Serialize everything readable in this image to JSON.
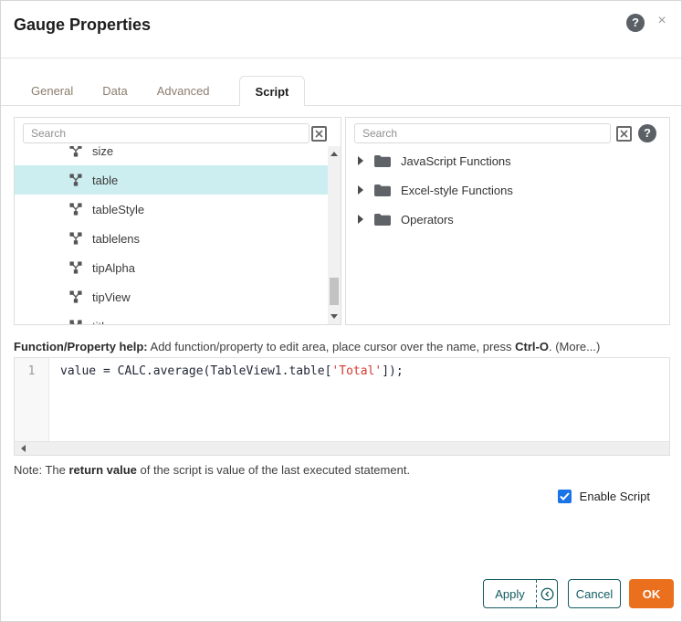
{
  "dialog": {
    "title": "Gauge Properties",
    "help_icon": "?",
    "close_icon": "×"
  },
  "tabs": [
    {
      "label": "General",
      "active": false
    },
    {
      "label": "Data",
      "active": false
    },
    {
      "label": "Advanced",
      "active": false
    },
    {
      "label": "Script",
      "active": true
    }
  ],
  "properties_panel": {
    "search_placeholder": "Search",
    "items": [
      {
        "label": "size",
        "selected": false
      },
      {
        "label": "table",
        "selected": true
      },
      {
        "label": "tableStyle",
        "selected": false
      },
      {
        "label": "tablelens",
        "selected": false
      },
      {
        "label": "tipAlpha",
        "selected": false
      },
      {
        "label": "tipView",
        "selected": false
      },
      {
        "label": "title",
        "selected": false
      }
    ]
  },
  "functions_panel": {
    "search_placeholder": "Search",
    "help_icon": "?",
    "tree": [
      {
        "label": "JavaScript Functions",
        "expanded": false
      },
      {
        "label": "Excel-style Functions",
        "expanded": false
      },
      {
        "label": "Operators",
        "expanded": false
      }
    ]
  },
  "help_line": {
    "bold_prefix": "Function/Property help:",
    "text": " Add function/property to edit area, place cursor over the name, press ",
    "shortcut": "Ctrl-O",
    "separator": ". ",
    "more_link": "(More...)"
  },
  "editor": {
    "line_number": "1",
    "code_before": "value = CALC.average(TableView1.table[",
    "code_string": "'Total'",
    "code_after": "]);"
  },
  "note": {
    "prefix": "Note: The ",
    "bold": "return value",
    "suffix": " of the script is value of the last executed statement."
  },
  "enable_script": {
    "label": "Enable Script",
    "checked": true
  },
  "buttons": {
    "apply": "Apply",
    "cancel": "Cancel",
    "ok": "OK"
  },
  "colors": {
    "accent_teal": "#125a62",
    "ok_orange": "#ea701e",
    "checkbox_blue": "#1a73e8",
    "selection_cyan": "#cdeef0",
    "string_red": "#d43a32",
    "tab_inactive": "#8d7e6e"
  }
}
